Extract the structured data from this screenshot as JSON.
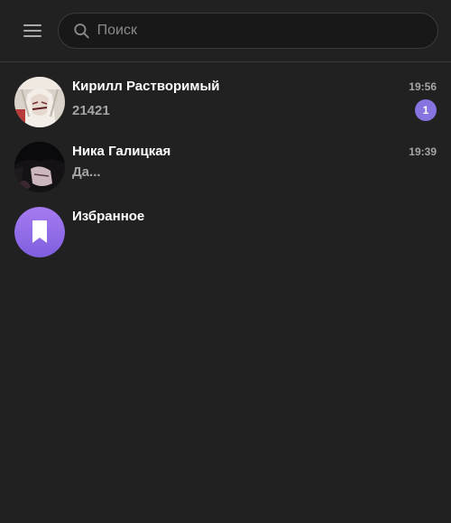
{
  "search": {
    "placeholder": "Поиск",
    "value": ""
  },
  "chats": [
    {
      "name": "Кирилл Растворимый",
      "time": "19:56",
      "preview": "21421",
      "unread": "1",
      "avatar": "photo-avatar"
    },
    {
      "name": "Ника Галицкая",
      "time": "19:39",
      "preview": "Да...",
      "unread": "",
      "avatar": "photo-avatar"
    },
    {
      "name": "Избранное",
      "time": "",
      "preview": "",
      "unread": "",
      "avatar": "bookmark-icon"
    }
  ],
  "colors": {
    "background": "#212121",
    "accent": "#8774e1",
    "saved_gradient_top": "#a67bf0",
    "saved_gradient_bottom": "#7e5fe0"
  }
}
